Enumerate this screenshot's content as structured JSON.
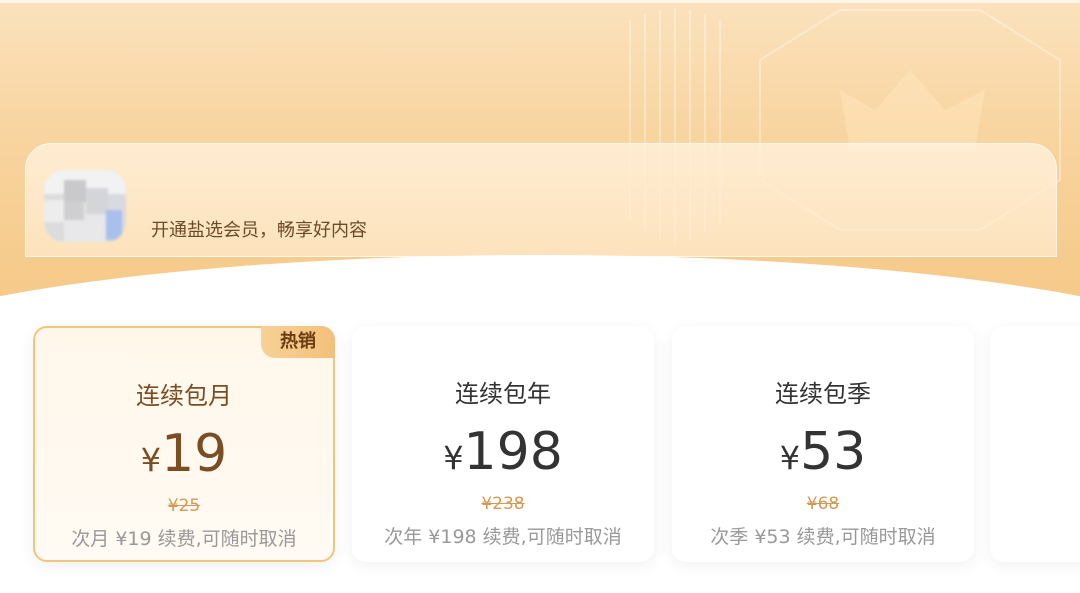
{
  "header": {
    "username": "",
    "tagline": "开通盐选会员，畅享好内容"
  },
  "plans": [
    {
      "name": "连续包月",
      "currency": "¥",
      "price": "19",
      "original_price": "¥25",
      "renewal_note": "次月 ¥19 续费,可随时取消",
      "badge": "热销",
      "selected": true
    },
    {
      "name": "连续包年",
      "currency": "¥",
      "price": "198",
      "original_price": "¥238",
      "renewal_note": "次年 ¥198 续费,可随时取消",
      "selected": false
    },
    {
      "name": "连续包季",
      "currency": "¥",
      "price": "53",
      "original_price": "¥68",
      "renewal_note": "次季 ¥53 续费,可随时取消",
      "selected": false
    }
  ],
  "colors": {
    "accent_gold": "#f1c57b",
    "brand_brown": "#7a4e22",
    "strike_price": "#d49a52"
  },
  "icons": {
    "avatar": "user-avatar",
    "decoration": "crown-icon"
  }
}
